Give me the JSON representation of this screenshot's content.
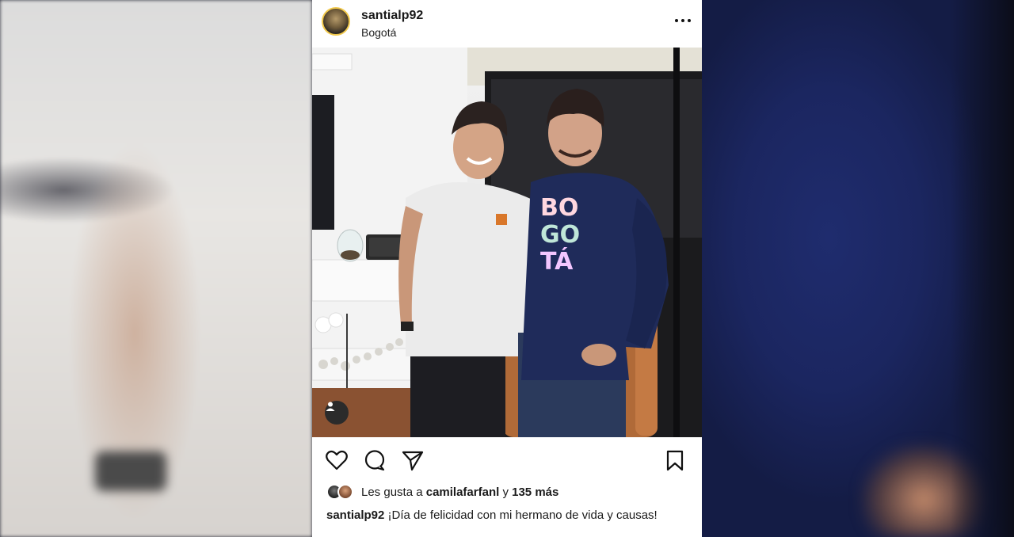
{
  "post": {
    "username": "santialp92",
    "location": "Bogotá",
    "likes": {
      "prefix": "Les gusta a",
      "user": "camilafarfanl",
      "connector": "y",
      "count": "135 más"
    },
    "caption": {
      "username": "santialp92",
      "text": "¡Día de felicidad con mi hermano de vida y causas!"
    },
    "sweater_text": "BOGOTÁ"
  },
  "icons": {
    "more": "more-options-icon",
    "like": "heart-icon",
    "comment": "comment-icon",
    "share": "share-icon",
    "save": "bookmark-icon",
    "tag": "user-tag-icon"
  }
}
